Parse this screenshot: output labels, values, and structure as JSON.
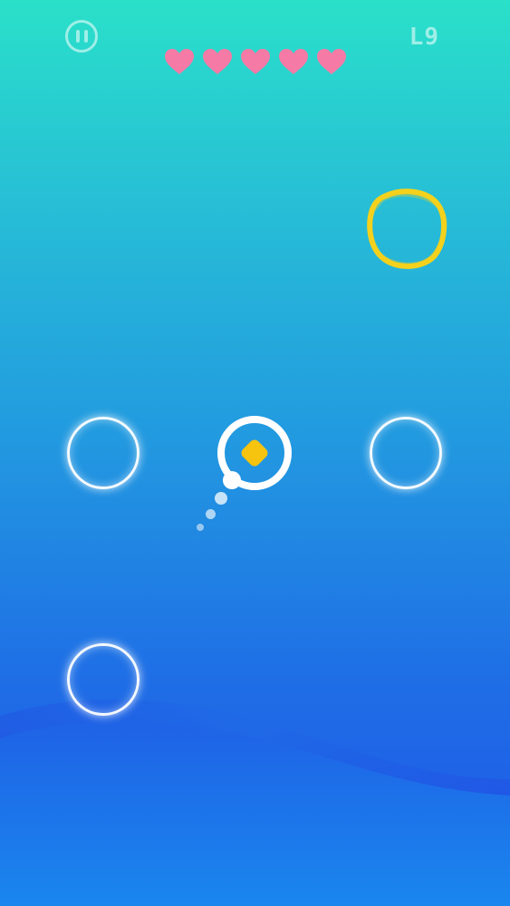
{
  "hud": {
    "level": "L9",
    "lives": 5,
    "lives_max": 5
  },
  "colors": {
    "heart": "#f57aa6",
    "target": "#f4d21c",
    "player_core": "#f6c30e",
    "ring": "#ffffff"
  },
  "icons": {
    "pause": "pause-icon",
    "heart": "heart-icon",
    "target": "target-blob-icon",
    "player": "player-diamond-icon"
  }
}
